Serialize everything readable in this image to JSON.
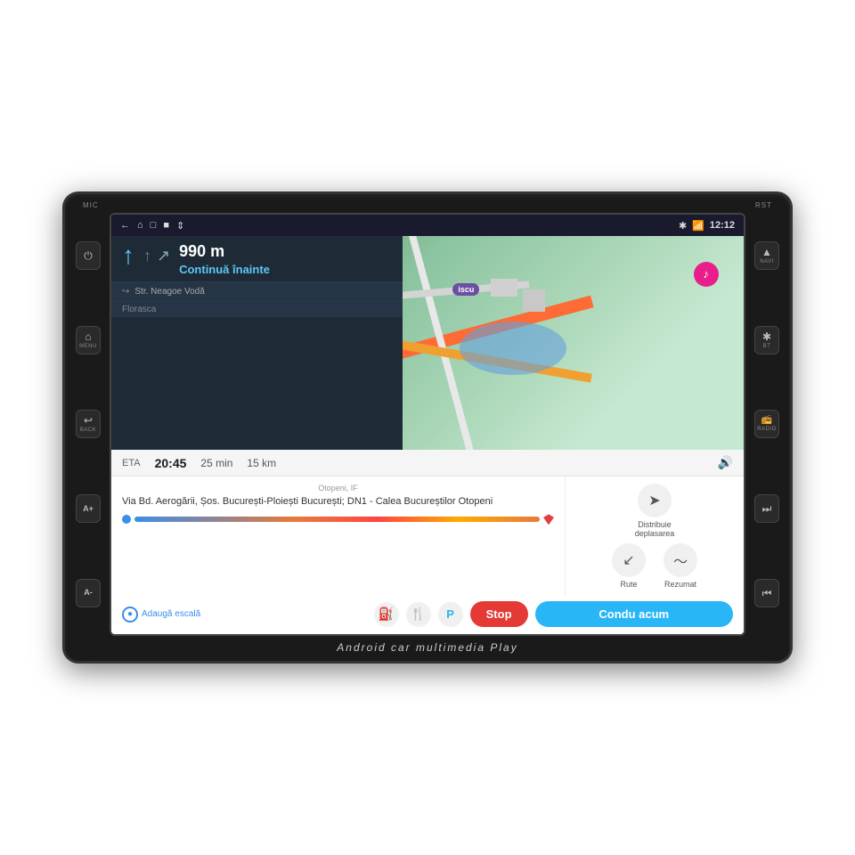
{
  "device": {
    "top_left_label": "MIC",
    "top_right_label": "RST",
    "bottom_label": "Android car multimedia Play"
  },
  "status_bar": {
    "nav_icons": [
      "←",
      "⌂",
      "□",
      "■",
      "↕"
    ],
    "time": "12:12",
    "wifi_icon": "wifi",
    "bt_icon": "bt"
  },
  "navigation": {
    "distance": "990 m",
    "instruction": "Continuă înainte",
    "street_name": "Str. Neagoe Vodă",
    "florasca_label": "Florasca"
  },
  "eta_bar": {
    "eta_label": "ETA",
    "eta_time": "20:45",
    "duration": "25 min",
    "distance": "15 km"
  },
  "route": {
    "from_label": "Otopeni, IF",
    "description": "Via Bd. Aerogării, Șos. București-Ploiești București; DN1 - Calea Bucureștilor Otopeni",
    "share_label": "Distribuie deplasarea",
    "routes_label": "Rute",
    "summary_label": "Rezumat",
    "add_stop_label": "Adaugă escală"
  },
  "buttons": {
    "stop_label": "Stop",
    "drive_label": "Condu acum"
  },
  "left_buttons": [
    {
      "icon": "⏻",
      "label": ""
    },
    {
      "icon": "⌂",
      "label": "MENU"
    },
    {
      "icon": "↩",
      "label": "BACK"
    },
    {
      "icon": "A+",
      "label": ""
    },
    {
      "icon": "A-",
      "label": ""
    }
  ],
  "right_buttons": [
    {
      "icon": "▲",
      "label": "NAVI"
    },
    {
      "icon": "✱",
      "label": "BT"
    },
    {
      "icon": "📻",
      "label": "RADIO"
    },
    {
      "icon": "⏭",
      "label": ""
    },
    {
      "icon": "⏮",
      "label": ""
    }
  ],
  "waze_badge": "iscu",
  "music_icon": "♪"
}
